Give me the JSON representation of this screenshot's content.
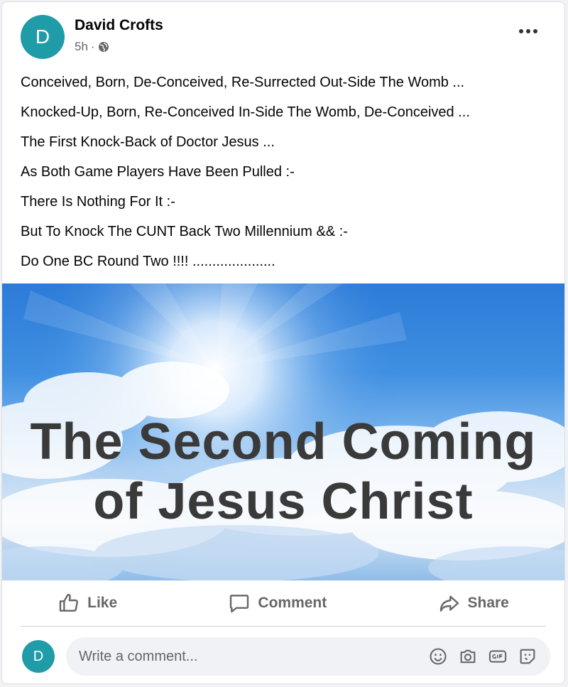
{
  "post": {
    "author": "David Crofts",
    "avatar_letter": "D",
    "time": "5h",
    "separator": "·",
    "visibility_icon": "globe-icon",
    "lines": [
      "Conceived, Born, De-Conceived, Re-Surrected Out-Side The Womb ...",
      "Knocked-Up, Born, Re-Conceived In-Side The Womb, De-Conceived ...",
      "The First Knock-Back of Doctor Jesus ...",
      "As Both Game Players Have Been Pulled :-",
      "There Is Nothing For It :-",
      "But To Knock The CUNT Back Two Millennium && :-",
      "Do One BC Round Two !!!! ....................."
    ],
    "image": {
      "title_line1": "The Second Coming",
      "title_line2": "of Jesus Christ"
    }
  },
  "actions": {
    "like": "Like",
    "comment": "Comment",
    "share": "Share"
  },
  "composer": {
    "avatar_letter": "D",
    "placeholder": "Write a comment...",
    "icons": [
      "emoji-icon",
      "camera-icon",
      "gif-icon",
      "sticker-icon"
    ]
  },
  "colors": {
    "avatar": "#1f9ca8",
    "secondary_text": "#65676b",
    "sky": "#3f8fe2"
  }
}
